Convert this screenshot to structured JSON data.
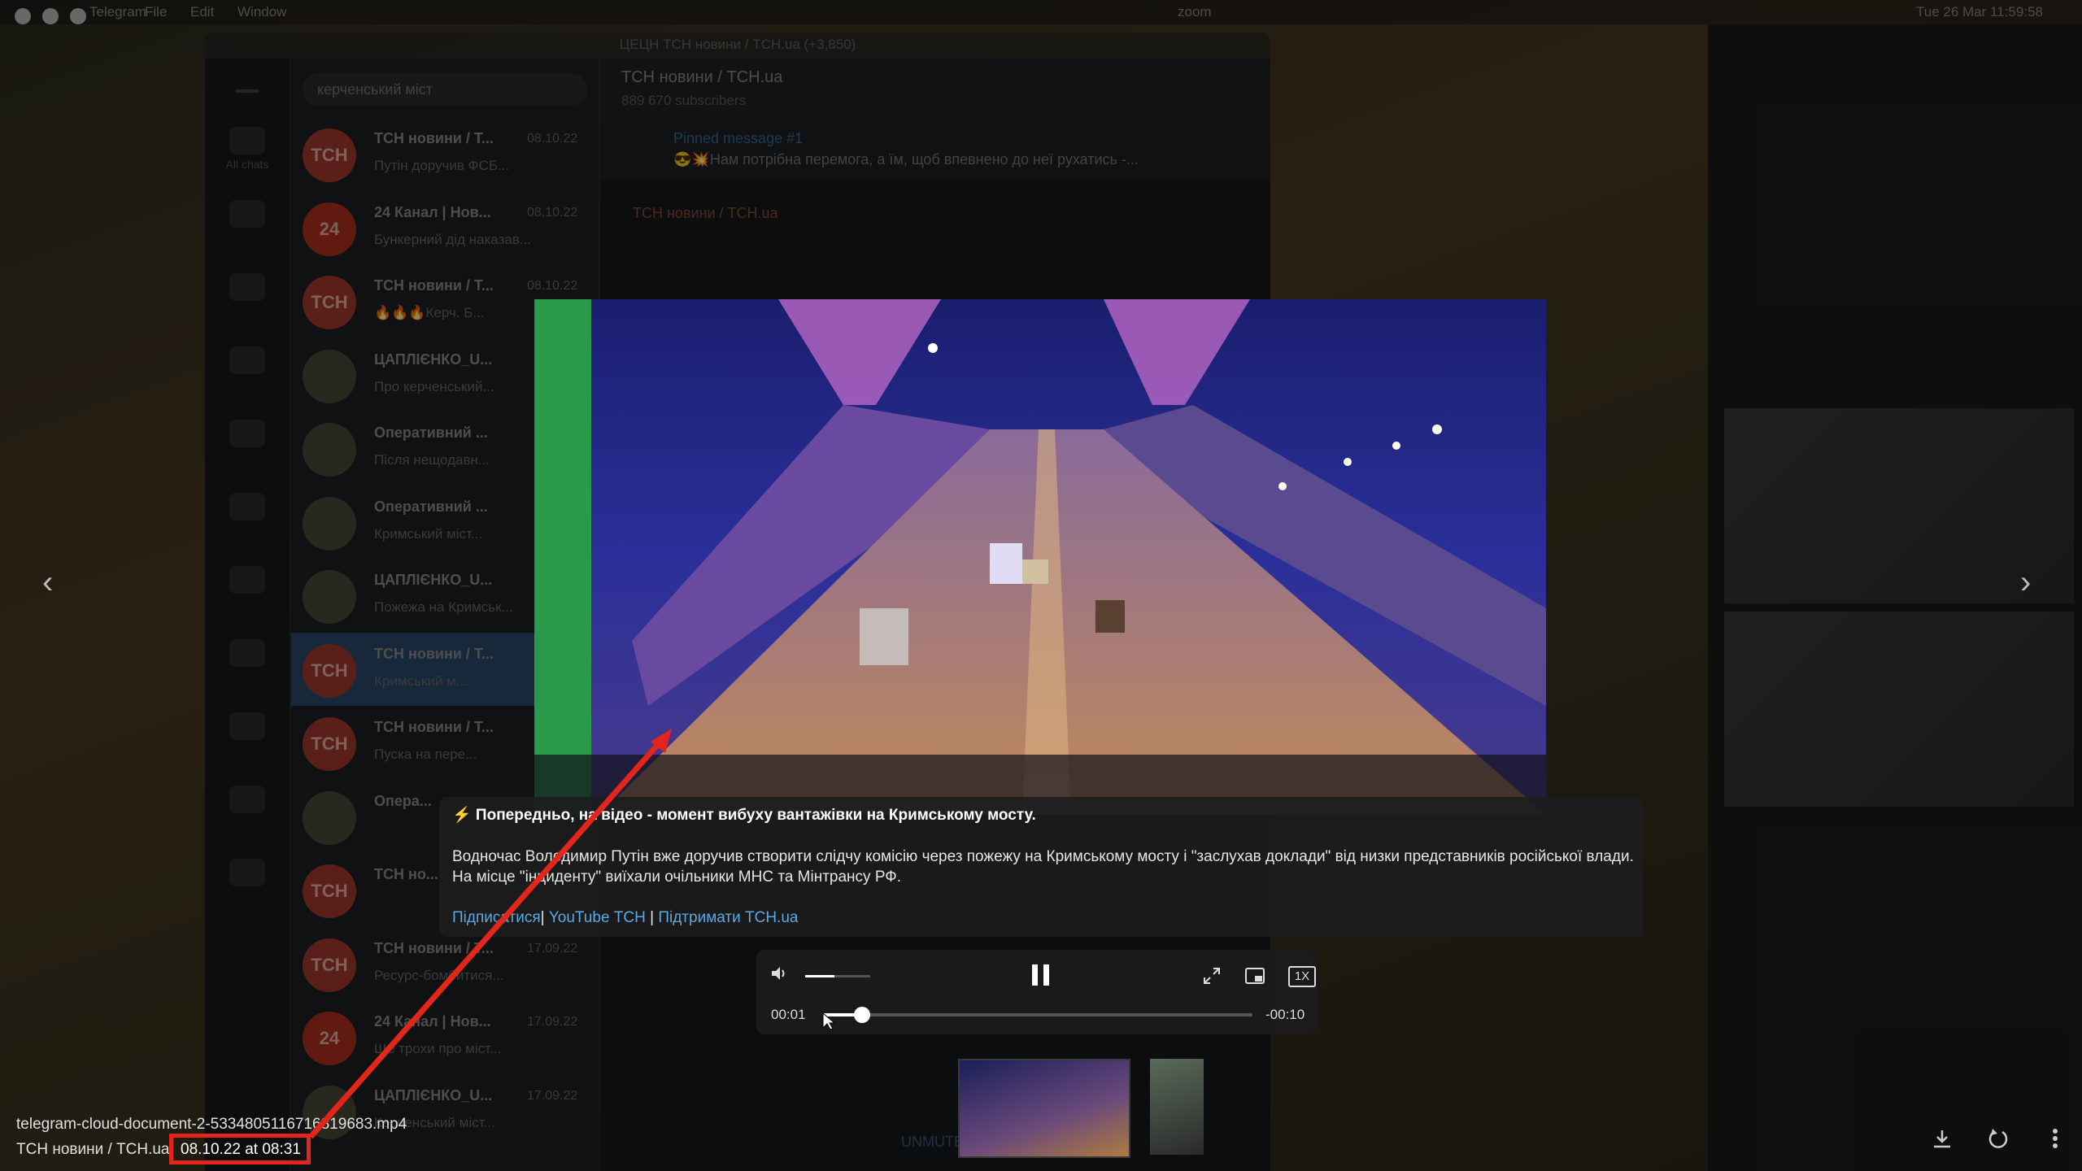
{
  "menubar": {
    "app": "Telegram",
    "menus": [
      "File",
      "Edit",
      "Window"
    ],
    "zoom_label": "zoom",
    "clock": "Tue 26 Mar 11:59:58"
  },
  "window": {
    "title": "ЦЕЦН ТСН новини / ТСН.ua (+3,850)"
  },
  "sidebar": {
    "folders": [
      {
        "label": "All chats",
        "icon": "chats-icon"
      },
      {
        "label": "",
        "icon": "flag-icon"
      },
      {
        "label": "",
        "icon": "folder-icon"
      },
      {
        "label": "",
        "icon": "folder-icon"
      },
      {
        "label": "",
        "icon": "folder-icon"
      },
      {
        "label": "",
        "icon": "folder-icon"
      },
      {
        "label": "",
        "icon": "folder-icon"
      },
      {
        "label": "",
        "icon": "folder-icon"
      },
      {
        "label": "",
        "icon": "folder-icon"
      },
      {
        "label": "",
        "icon": "folder-icon"
      },
      {
        "label": "",
        "icon": "folder-icon"
      }
    ]
  },
  "search": {
    "value": "керченський міст"
  },
  "chats": [
    {
      "avatar": "ТСН",
      "name": "ТСН новини / Т...",
      "time": "08.10.22",
      "preview": "Путін доручив ФСБ..."
    },
    {
      "avatar": "24",
      "name": "24 Канал | Нов...",
      "time": "08.10.22",
      "preview": "Бункерний дід наказав..."
    },
    {
      "avatar": "ТСН",
      "name": "ТСН новини / Т...",
      "time": "08.10.22",
      "preview": "🔥🔥🔥Керч. Б..."
    },
    {
      "avatar": "",
      "name": "ЦАПЛІЄНКО_U...",
      "time": "",
      "preview": "Про керченський..."
    },
    {
      "avatar": "",
      "name": "Оперативний ...",
      "time": "",
      "preview": "Після нещодавн..."
    },
    {
      "avatar": "",
      "name": "Оперативний ...",
      "time": "",
      "preview": "Кримський міст..."
    },
    {
      "avatar": "",
      "name": "ЦАПЛІЄНКО_U...",
      "time": "",
      "preview": "Пожежа на Кримськ..."
    },
    {
      "avatar": "ТСН",
      "name": "ТСН новини / Т...",
      "time": "",
      "preview": "Кримський м..."
    },
    {
      "avatar": "ТСН",
      "name": "ТСН новини / Т...",
      "time": "",
      "preview": "Пуска на пере..."
    },
    {
      "avatar": "",
      "name": "Опера...",
      "time": "",
      "preview": ""
    },
    {
      "avatar": "ТСН",
      "name": "ТСН но...",
      "time": "",
      "preview": ""
    },
    {
      "avatar": "ТСН",
      "name": "ТСН новини / Т...",
      "time": "17.09.22",
      "preview": "Ресурс-бомбитися..."
    },
    {
      "avatar": "24",
      "name": "24 Канал | Нов...",
      "time": "17.09.22",
      "preview": "Ще трохи про міст..."
    },
    {
      "avatar": "",
      "name": "ЦАПЛІЄНКО_U...",
      "time": "17.09.22",
      "preview": "Керченський міст..."
    }
  ],
  "conversation": {
    "title": "ТСН новини / ТСН.ua",
    "subtitle": "889 670 subscribers",
    "pinned_title": "Pinned message #1",
    "pinned_text": "😎💥Нам потрібна перемога, а їм, щоб впевнено до неї рухатись -...",
    "forward_label": "ТСН новини / ТСН.ua",
    "unmute": "UNMUTE"
  },
  "viewer": {
    "caption_headline": "⚡️ Попередньо, на відео - момент вибуху вантажівки на Кримському мосту.",
    "caption_body": "Водночас Володимир Путін вже доручив створити слідчу комісію через пожежу на Кримському мосту і \"заслухав доклади\" від низки представників російської влади. На місце \"інциденту\" виїхали очільники МНС та Мінтрансу РФ.",
    "links": [
      "Підписатися",
      "YouTube ТСН",
      "Підтримати ТСН.ua"
    ],
    "separator": "|",
    "time_elapsed": "00:01",
    "time_remaining": "-00:10",
    "progress_fraction": 0.09,
    "volume_fraction": 0.45,
    "speed": "1X",
    "filename": "telegram-cloud-document-2-5334805116716819683.mp4",
    "channel": "ТСН новини / ТСН.ua",
    "date": "08.10.22 at 08:31"
  },
  "annotation": {
    "color": "#e3261b"
  }
}
